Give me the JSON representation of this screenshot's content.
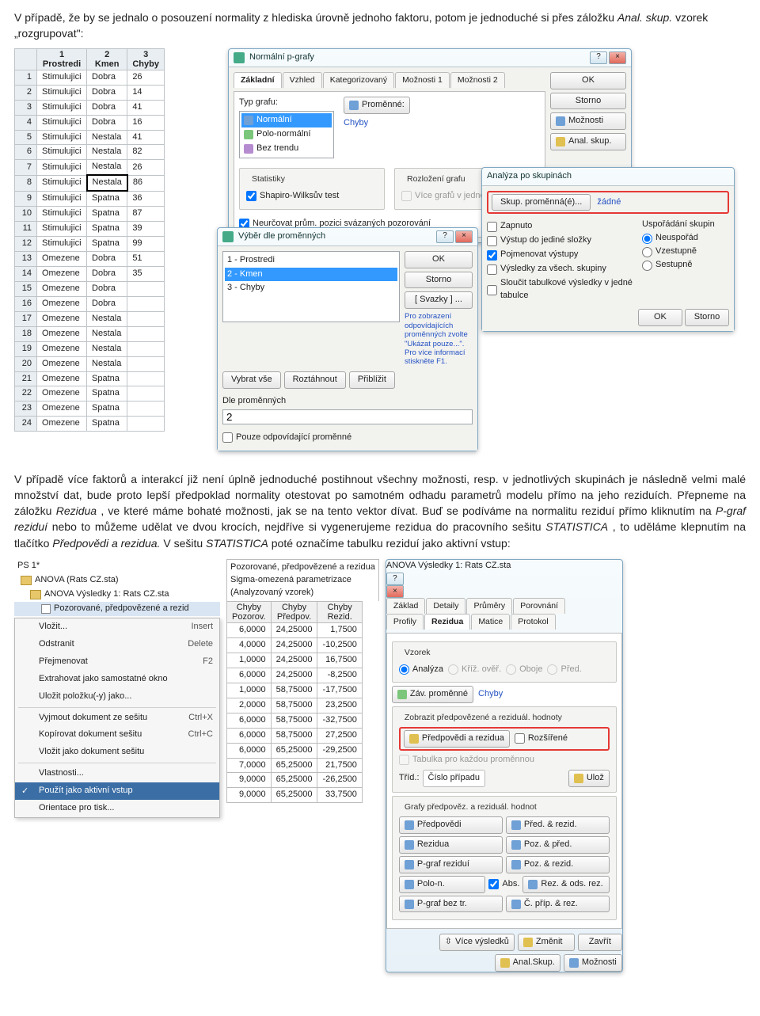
{
  "intro": {
    "p1": "V případě, že by se jednalo o posouzení normality z hlediska úrovně jednoho faktoru, potom je jednoduché si přes záložku ",
    "p1_it1": "Anal. skup.",
    "p1_sep": " vzorek „rozgrupovat\":"
  },
  "sheet": {
    "headers": [
      "",
      "1\nProstredi",
      "2\nKmen",
      "3\nChyby"
    ],
    "rows": [
      [
        "1",
        "Stimulujici",
        "Dobra",
        "26"
      ],
      [
        "2",
        "Stimulujici",
        "Dobra",
        "14"
      ],
      [
        "3",
        "Stimulujici",
        "Dobra",
        "41"
      ],
      [
        "4",
        "Stimulujici",
        "Dobra",
        "16"
      ],
      [
        "5",
        "Stimulujici",
        "Nestala",
        "41"
      ],
      [
        "6",
        "Stimulujici",
        "Nestala",
        "82"
      ],
      [
        "7",
        "Stimulujici",
        "Nestala",
        "26"
      ],
      [
        "8",
        "Stimulujici",
        "Nestala",
        "86"
      ],
      [
        "9",
        "Stimulujici",
        "Spatna",
        "36"
      ],
      [
        "10",
        "Stimulujici",
        "Spatna",
        "87"
      ],
      [
        "11",
        "Stimulujici",
        "Spatna",
        "39"
      ],
      [
        "12",
        "Stimulujici",
        "Spatna",
        "99"
      ],
      [
        "13",
        "Omezene",
        "Dobra",
        "51"
      ],
      [
        "14",
        "Omezene",
        "Dobra",
        "35"
      ],
      [
        "15",
        "Omezene",
        "Dobra",
        ""
      ],
      [
        "16",
        "Omezene",
        "Dobra",
        ""
      ],
      [
        "17",
        "Omezene",
        "Nestala",
        ""
      ],
      [
        "18",
        "Omezene",
        "Nestala",
        ""
      ],
      [
        "19",
        "Omezene",
        "Nestala",
        ""
      ],
      [
        "20",
        "Omezene",
        "Nestala",
        ""
      ],
      [
        "21",
        "Omezene",
        "Spatna",
        ""
      ],
      [
        "22",
        "Omezene",
        "Spatna",
        ""
      ],
      [
        "23",
        "Omezene",
        "Spatna",
        ""
      ],
      [
        "24",
        "Omezene",
        "Spatna",
        ""
      ]
    ],
    "selected_cell": {
      "row": 8,
      "col": 2
    }
  },
  "dlg_pgraf": {
    "title": "Normální p-grafy",
    "tabs": [
      "Základní",
      "Vzhled",
      "Kategorizovaný",
      "Možnosti 1",
      "Možnosti 2"
    ],
    "typ_grafu_label": "Typ grafu:",
    "types": [
      "Normální",
      "Polo-normální",
      "Bez trendu"
    ],
    "promenne_btn": "Proměnné:",
    "promenne_val": "Chyby",
    "stat_label": "Statistiky",
    "shapiro": "Shapiro-Wilksův test",
    "rozlozeni_label": "Rozložení grafu",
    "vice_grafu": "Více grafů v jednom",
    "neurcovat": "Neurčovat prům. pozici svázaných pozorování",
    "right_buttons": {
      "ok": "OK",
      "storno": "Storno",
      "moznosti": "Možnosti",
      "anal": "Anal. skup."
    }
  },
  "dlg_analyza": {
    "title": "Analýza po skupinách",
    "skup_btn": "Skup. proměnná(é)...",
    "zadne": "žádné",
    "zapnuto": "Zapnuto",
    "vystup_slozky": "Výstup do jediné složky",
    "pojmenovat": "Pojmenovat výstupy",
    "vysledky": "Výsledky za všech. skupiny",
    "sloucit": "Sloučit tabulkové výsledky v jedné tabulce",
    "usporadani_label": "Uspořádání skupin",
    "opts": [
      "Neuspořád",
      "Vzestupně",
      "Sestupně"
    ],
    "ok": "OK",
    "storno": "Storno"
  },
  "dlg_vyber": {
    "title": "Výběr dle proměnných",
    "items": [
      "1 - Prostredi",
      "2 - Kmen",
      "3 - Chyby"
    ],
    "btns": {
      "ok": "OK",
      "storno": "Storno",
      "svazky": "[ Svazky ] ..."
    },
    "note": "Pro zobrazení odpovídajících proměnných zvolte \"Ukázat pouze...\". Pro více informací stiskněte F1.",
    "vybrat": "Vybrat vše",
    "roztahnout": "Roztáhnout",
    "priblizit": "Přiblížit",
    "dle_label": "Dle proměnných",
    "dle_value": "2",
    "pouze": "Pouze odpovídající proměnné"
  },
  "midtext": {
    "p": "V případě více faktorů a interakcí již není úplně jednoduché postihnout všechny možnosti, resp. v jednotlivých skupinách je následně velmi malé množství dat, bude proto lepší předpoklad normality otestovat po samotném odhadu parametrů modelu přímo na jeho reziduích. Přepneme na záložku ",
    "it1": "Rezidua",
    "p2": ", ve které máme bohaté možnosti, jak se na tento vektor dívat. Buď se podíváme na normalitu reziduí přímo kliknutím na ",
    "it2": "P-graf reziduí",
    "p3": " nebo to můžeme udělat ve dvou krocích, nejdříve si vygenerujeme rezidua do pracovního sešitu ",
    "it3": "STATISTICA",
    "p4": ", to uděláme klepnutím na tlačítko ",
    "it4": "Předpovědi a rezidua.",
    "p5": " V sešitu ",
    "it5": "STATISTICA",
    "p6": " poté označíme tabulku reziduí jako aktivní vstup:"
  },
  "tree": {
    "ps": "PS 1*",
    "items": [
      "ANOVA (Rats CZ.sta)",
      "ANOVA Výsledky 1: Rats CZ.sta",
      "Pozorované, předpovězené a rezid"
    ]
  },
  "ctx": [
    {
      "label": "Vložit...",
      "sc": "Insert"
    },
    {
      "label": "Odstranit",
      "sc": "Delete"
    },
    {
      "label": "Přejmenovat",
      "sc": "F2"
    },
    {
      "label": "Extrahovat jako samostatné okno",
      "sc": ""
    },
    {
      "label": "Uložit položku(-y) jako...",
      "sc": ""
    },
    {
      "sep": true
    },
    {
      "label": "Vyjmout dokument ze sešitu",
      "sc": "Ctrl+X",
      "icon": "cut"
    },
    {
      "label": "Kopírovat dokument sešitu",
      "sc": "Ctrl+C",
      "icon": "copy"
    },
    {
      "label": "Vložit jako dokument sešitu",
      "sc": "",
      "icon": "paste"
    },
    {
      "sep": true
    },
    {
      "label": "Vlastnosti...",
      "sc": ""
    },
    {
      "label": "Použít jako aktivní vstup",
      "sc": "",
      "sel": true,
      "check": true
    },
    {
      "label": "Orientace pro tisk...",
      "sc": ""
    }
  ],
  "datagrid": {
    "caption": "Pozorované, předpovězené a rezidua\nSigma-omezená parametrizace\n(Analyzovaný vzorek)",
    "headers": [
      "Chyby\nPozorov.",
      "Chyby\nPředpov.",
      "Chyby\nRezid."
    ],
    "rows": [
      [
        "6,0000",
        "24,25000",
        "1,7500"
      ],
      [
        "4,0000",
        "24,25000",
        "-10,2500"
      ],
      [
        "1,0000",
        "24,25000",
        "16,7500"
      ],
      [
        "6,0000",
        "24,25000",
        "-8,2500"
      ],
      [
        "1,0000",
        "58,75000",
        "-17,7500"
      ],
      [
        "2,0000",
        "58,75000",
        "23,2500"
      ],
      [
        "6,0000",
        "58,75000",
        "-32,7500"
      ],
      [
        "6,0000",
        "58,75000",
        "27,2500"
      ],
      [
        "6,0000",
        "65,25000",
        "-29,2500"
      ],
      [
        "7,0000",
        "65,25000",
        "21,7500"
      ],
      [
        "9,0000",
        "65,25000",
        "-26,2500"
      ],
      [
        "9,0000",
        "65,25000",
        "33,7500"
      ]
    ]
  },
  "anova": {
    "title": "ANOVA Výsledky 1: Rats CZ.sta",
    "tabs1": [
      "Základ",
      "Detaily",
      "Průměry",
      "Porovnání"
    ],
    "tabs2": [
      "Profily",
      "Rezidua",
      "Matice",
      "Protokol"
    ],
    "vzorek": "Vzorek",
    "vzorek_opts": [
      "Analýza",
      "Kříž. ověř.",
      "Oboje",
      "Před."
    ],
    "zav_btn": "Záv. proměnné",
    "zav_val": "Chyby",
    "zobrazit": "Zobrazit předpovězené a reziduál. hodnoty",
    "predp_btn": "Předpovědi a rezidua",
    "rozs": "Rozšířené",
    "tabulka": "Tabulka pro každou proměnnou",
    "trid": "Tříd.:",
    "trid_val": "Číslo případu",
    "uloz": "Ulož",
    "grafy": "Grafy předpověz. a reziduál. hodnot",
    "gbtns": [
      [
        "Předpovědi",
        "Před. & rezid."
      ],
      [
        "Rezidua",
        "Poz. & před."
      ],
      [
        "P-graf reziduí",
        "Poz. & rezid."
      ],
      [
        "Polo-n.",
        "Rez. & ods. rez."
      ],
      [
        "P-graf bez tr.",
        "Č. příp. & rez."
      ]
    ],
    "abs": "Abs.",
    "bottom": [
      "Více výsledků",
      "Změnit",
      "Zavřít",
      "Anal.Skup.",
      "Možnosti"
    ]
  }
}
